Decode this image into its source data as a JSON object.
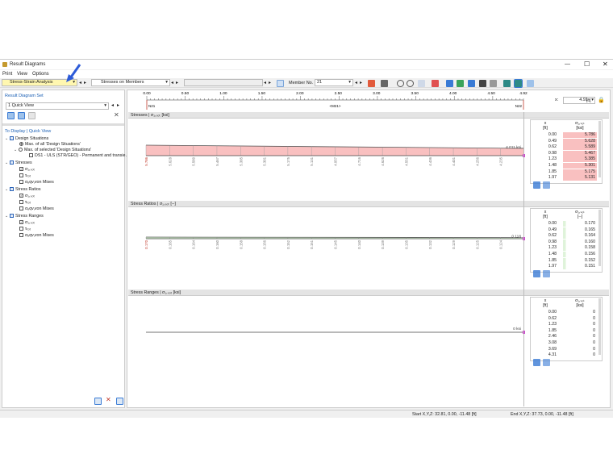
{
  "window": {
    "title": "Result Diagrams"
  },
  "menu": [
    "Print",
    "View",
    "Options"
  ],
  "toolbar": {
    "analysis_combo": "Stress-Strain Analysis",
    "mode_combo": "Stresses on Members",
    "member_label": "Member No.",
    "member_no": "21"
  },
  "left_panel": {
    "set_title": "Result Diagram Set",
    "quick_view": "1   Quick View",
    "to_display": "To Display | Quick View",
    "tree": [
      {
        "label": "Design Situations",
        "type": "group"
      },
      {
        "label": "Max. of all 'Design Situations'",
        "type": "radio",
        "checked": true
      },
      {
        "label": "Max. of selected 'Design Situations'",
        "type": "radio",
        "checked": false
      },
      {
        "label": "DS1 - ULS (STR/GEO) - Permanent and transie...",
        "type": "check",
        "checked": false
      },
      {
        "label": "Stresses",
        "type": "group"
      },
      {
        "label": "σ₁,ₛₒₜ",
        "type": "check",
        "checked": true
      },
      {
        "label": "τₜₒₜ",
        "type": "check",
        "checked": false
      },
      {
        "label": "σₑqv,von Mises",
        "type": "check",
        "checked": false
      },
      {
        "label": "Stress Ratios",
        "type": "group"
      },
      {
        "label": "σ₁,ₛₒₜ",
        "type": "check",
        "checked": true
      },
      {
        "label": "τₜₒₜ",
        "type": "check",
        "checked": false
      },
      {
        "label": "σₑqv,von Mises",
        "type": "check",
        "checked": false
      },
      {
        "label": "Stress Ranges",
        "type": "group"
      },
      {
        "label": "σ₁,ₛₒₜ",
        "type": "check",
        "checked": true
      },
      {
        "label": "τₜₒₜ",
        "type": "check",
        "checked": false
      },
      {
        "label": "σₑqv,von Mises",
        "type": "check",
        "checked": false
      }
    ]
  },
  "ruler": {
    "ticks": [
      "0.00",
      "0.50",
      "1.00",
      "1.50",
      "2.00",
      "2.50",
      "3.00",
      "3.50",
      "4.00",
      "4.50",
      "4.92"
    ],
    "n_start": "N21",
    "member": "<M21>",
    "n_end": "N22",
    "x_label": "x:",
    "x_value": "4.91",
    "unit": "[ft]"
  },
  "panels": [
    {
      "title": "Stresses | σ₁,ₛₒₜ [ksi]",
      "values": [
        "5.786",
        "5.628",
        "5.589",
        "5.467",
        "5.385",
        "5.301",
        "5.175",
        "5.131",
        "4.957",
        "4.716",
        "4.626",
        "4.551",
        "4.436",
        "4.401",
        "4.256",
        "4.235"
      ],
      "end_label": "4.011 ksi",
      "table": {
        "col1": "x",
        "col1_unit": "[ft]",
        "col2": "σ₁,ₛₒₜ",
        "col2_unit": "[ksi]",
        "rows": [
          [
            "0.00",
            "5.786"
          ],
          [
            "0.49",
            "5.628"
          ],
          [
            "0.62",
            "5.589"
          ],
          [
            "0.98",
            "5.467"
          ],
          [
            "1.23",
            "5.385"
          ],
          [
            "1.48",
            "5.301"
          ],
          [
            "1.85",
            "5.175"
          ],
          [
            "1.97",
            "5.131"
          ]
        ]
      }
    },
    {
      "title": "Stress Ratios | σ₁,ₛₒₜ [--]",
      "values": [
        "0.170",
        "0.165",
        "0.164",
        "0.160",
        "0.158",
        "0.156",
        "0.152",
        "0.151",
        "0.145",
        "0.140",
        "0.139",
        "0.135",
        "0.132",
        "0.129",
        "0.125",
        "0.124"
      ],
      "end_label": "0.118",
      "table": {
        "col1": "x",
        "col1_unit": "[ft]",
        "col2": "σ₁,ₛₒₜ",
        "col2_unit": "[--]",
        "rows": [
          [
            "0.00",
            "0.170"
          ],
          [
            "0.49",
            "0.165"
          ],
          [
            "0.62",
            "0.164"
          ],
          [
            "0.98",
            "0.160"
          ],
          [
            "1.23",
            "0.158"
          ],
          [
            "1.48",
            "0.156"
          ],
          [
            "1.85",
            "0.152"
          ],
          [
            "1.97",
            "0.151"
          ]
        ]
      }
    },
    {
      "title": "Stress Ranges | σ₁,ₛₒₜ [ksi]",
      "end_label": "0 ksi",
      "table": {
        "col1": "x",
        "col1_unit": "[ft]",
        "col2": "σ₁,ₛₒₜ",
        "col2_unit": "[ksi]",
        "rows": [
          [
            "0.00",
            "0"
          ],
          [
            "0.62",
            "0"
          ],
          [
            "1.23",
            "0"
          ],
          [
            "1.85",
            "0"
          ],
          [
            "2.46",
            "0"
          ],
          [
            "3.08",
            "0"
          ],
          [
            "3.69",
            "0"
          ],
          [
            "4.31",
            "0"
          ]
        ]
      }
    }
  ],
  "status": {
    "start": "Start X,Y,Z: 32.81, 0.00, -11.48 [ft]",
    "end": "End X,Y,Z: 37.73, 0.00, -11.48 [ft]"
  },
  "colors": {
    "stress_fill": "#f9c0c0",
    "ratio_fill": "#d6f3d0",
    "accent": "#1a5fb4"
  }
}
